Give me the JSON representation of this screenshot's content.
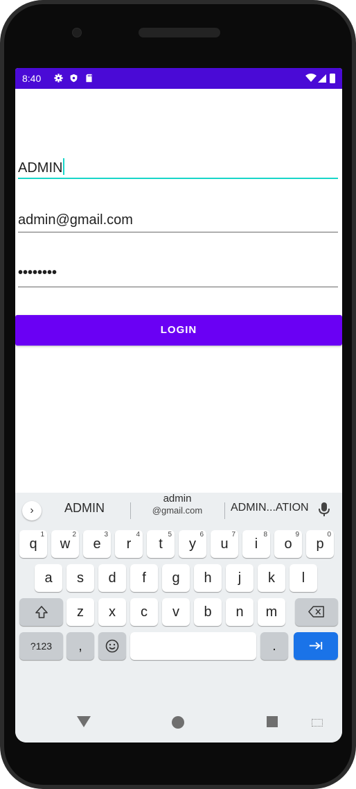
{
  "status_bar": {
    "time": "8:40",
    "left_icons": [
      "settings-icon",
      "shield-icon",
      "sd-card-icon"
    ],
    "right_icons": [
      "wifi-icon",
      "signal-icon",
      "battery-icon"
    ],
    "color": "#4a0ad6"
  },
  "form": {
    "name_value": "ADMIN",
    "email_value": "admin@gmail.com",
    "password_value": "••••••••",
    "login_label": "LOGIN",
    "accent_color": "#18d6c8",
    "button_color": "#6a00f4"
  },
  "keyboard": {
    "suggestions": {
      "expand_icon": "chevron-right-icon",
      "first": "ADMIN",
      "second_top": "admin",
      "second_bottom": "@gmail.com",
      "third": "ADMIN...ATION",
      "mic_icon": "mic-icon"
    },
    "row1": [
      {
        "label": "q",
        "hint": "1"
      },
      {
        "label": "w",
        "hint": "2"
      },
      {
        "label": "e",
        "hint": "3"
      },
      {
        "label": "r",
        "hint": "4"
      },
      {
        "label": "t",
        "hint": "5"
      },
      {
        "label": "y",
        "hint": "6"
      },
      {
        "label": "u",
        "hint": "7"
      },
      {
        "label": "i",
        "hint": "8"
      },
      {
        "label": "o",
        "hint": "9"
      },
      {
        "label": "p",
        "hint": "0"
      }
    ],
    "row2": [
      "a",
      "s",
      "d",
      "f",
      "g",
      "h",
      "j",
      "k",
      "l"
    ],
    "row3": [
      "z",
      "x",
      "c",
      "v",
      "b",
      "n",
      "m"
    ],
    "symbols_label": "?123",
    "comma_label": ",",
    "period_label": ".",
    "shift_icon": "shift-icon",
    "backspace_icon": "backspace-icon",
    "emoji_icon": "emoji-icon",
    "enter_icon": "tab-next-icon",
    "action_color": "#1a73e8"
  },
  "nav_bar": {
    "back_icon": "back-icon",
    "home_icon": "home-icon",
    "recents_icon": "recents-icon",
    "keyboard_switch_icon": "keyboard-switch-icon"
  }
}
